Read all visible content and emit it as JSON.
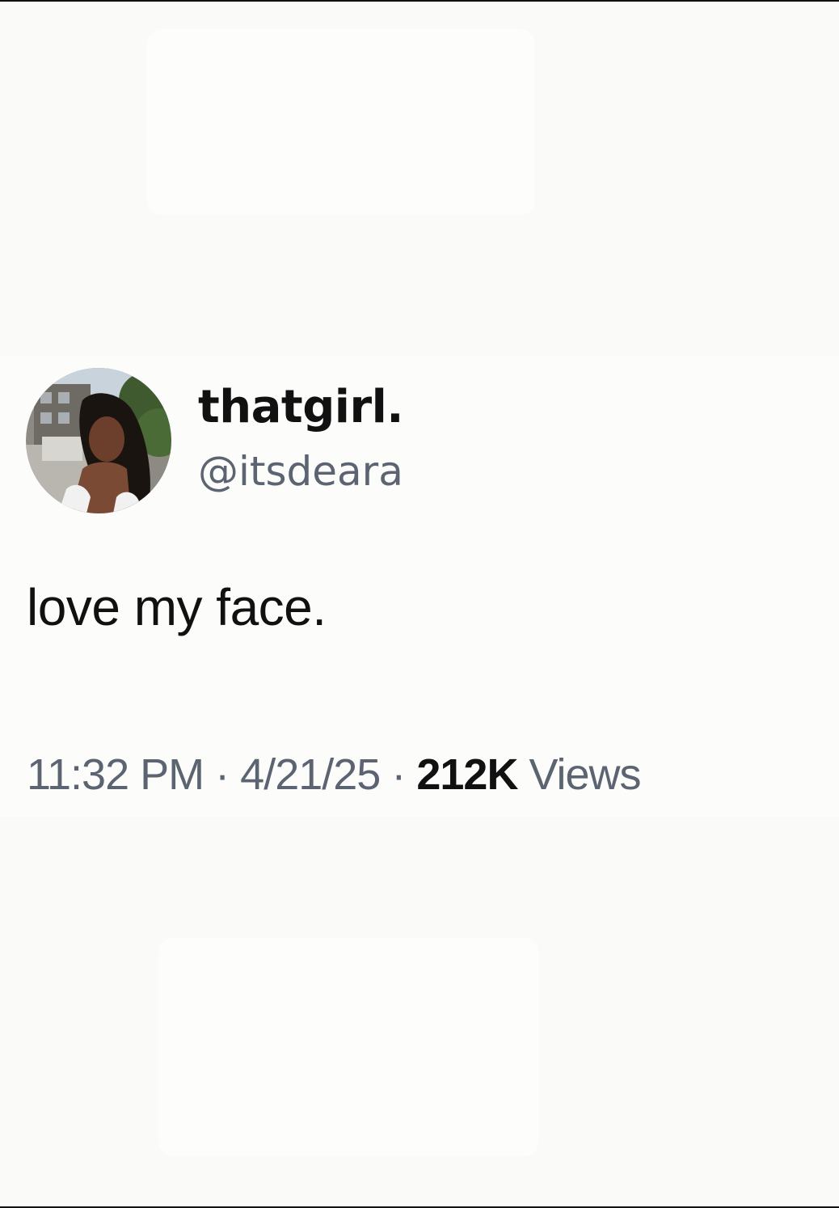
{
  "tweet": {
    "author": {
      "display_name": "thatgirl.",
      "handle": "@itsdeara"
    },
    "text": "love my face.",
    "meta": {
      "time": "11:32 PM",
      "separator": "·",
      "date": "4/21/25",
      "views_count": "212K",
      "views_label": "Views"
    }
  },
  "colors": {
    "text_primary": "#111111",
    "text_secondary": "#5b6470",
    "background": "#fafaf8"
  },
  "icons": {
    "avatar": "profile-photo"
  }
}
